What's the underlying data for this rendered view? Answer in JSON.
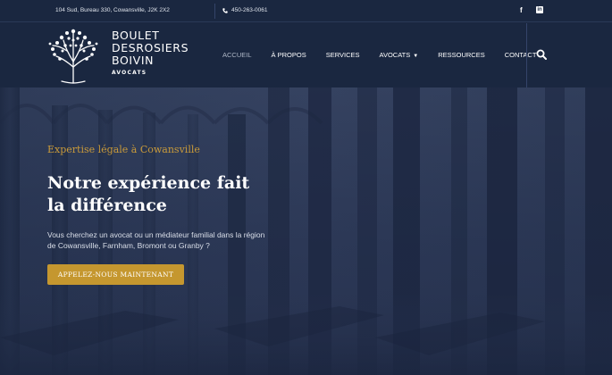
{
  "topbar": {
    "address": "104 Sud, Bureau 330, Cowansville, J2K 2X2",
    "phone": "450-263-0061",
    "social": [
      {
        "icon": "facebook-icon",
        "glyph": "f"
      },
      {
        "icon": "linkedin-icon",
        "glyph": "in"
      }
    ]
  },
  "logo": {
    "line1": "BOULET",
    "line2": "DESROSIERS",
    "line3": "BOIVIN",
    "sub": "AVOCATS"
  },
  "nav": {
    "items": [
      {
        "label": "ACCUEIL",
        "active": true
      },
      {
        "label": "À PROPOS"
      },
      {
        "label": "SERVICES"
      },
      {
        "label": "AVOCATS",
        "dropdown": true
      },
      {
        "label": "RESSOURCES"
      },
      {
        "label": "CONTACT"
      }
    ],
    "search_icon": "search-icon"
  },
  "hero": {
    "kicker": "Expertise légale à Cowansville",
    "title_line1": "Notre expérience fait",
    "title_line2": "la différence",
    "desc_line1": "Vous cherchez un avocat ou un médiateur familial dans la région",
    "desc_line2": "de Cowansville, Farnham, Bromont ou Granby ?",
    "cta": "APPELEZ-NOUS MAINTENANT"
  },
  "colors": {
    "navy": "#1a2740",
    "gold": "#c5972f",
    "kicker_gold": "#c99a3a"
  }
}
